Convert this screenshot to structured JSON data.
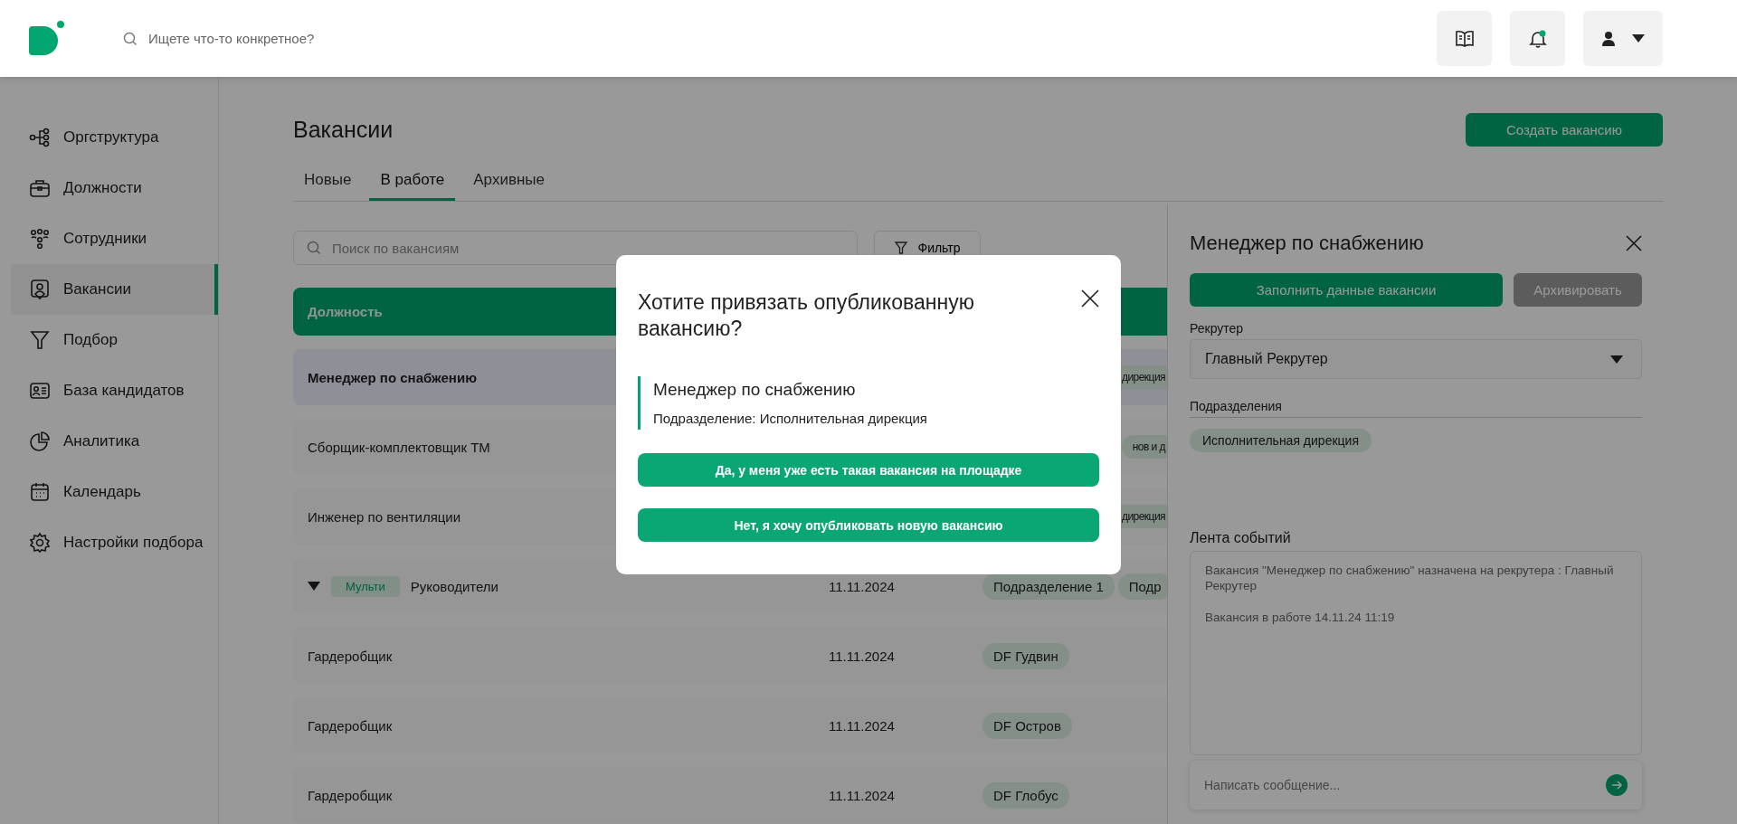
{
  "header": {
    "search": {
      "placeholder": "Ищете что-то конкретное?"
    },
    "notifications": {
      "unread": true
    }
  },
  "sidebar": {
    "items": [
      {
        "label": "Оргструктура",
        "selected": false
      },
      {
        "label": "Должности",
        "selected": false
      },
      {
        "label": "Сотрудники",
        "selected": false
      },
      {
        "label": "Вакансии",
        "selected": true
      },
      {
        "label": "Подбор",
        "selected": false
      },
      {
        "label": "База кандидатов",
        "selected": false
      },
      {
        "label": "Аналитика",
        "selected": false
      },
      {
        "label": "Календарь",
        "selected": false
      },
      {
        "label": "Настройки подбора",
        "selected": false
      }
    ]
  },
  "page": {
    "title": "Вакансии",
    "create_button": "Создать вакансию"
  },
  "tabs": [
    {
      "label": "Новые",
      "selected": false
    },
    {
      "label": "В работе",
      "selected": true
    },
    {
      "label": "Архивные",
      "selected": false
    }
  ],
  "search": {
    "placeholder": "Поиск по вакансиям"
  },
  "filter_button": "Фильтр",
  "table": {
    "columns": [
      "Должность"
    ],
    "rows": [
      {
        "kind": "single",
        "position": "Менеджер по снабжению",
        "selected": true,
        "departments": [
          "дирекция"
        ]
      },
      {
        "kind": "single",
        "position": "Сборщик-комплектовщик ТМ",
        "selected": false,
        "departments": [
          "нов и д"
        ]
      },
      {
        "kind": "single",
        "position": "Инженер по вентиляции",
        "selected": false,
        "departments": [
          "дирекция"
        ]
      },
      {
        "kind": "group",
        "badge": "Мульти",
        "position": "Руководители",
        "selected": false,
        "date": "11.11.2024",
        "departments": [
          "Подразделение 1",
          "Подр"
        ]
      },
      {
        "kind": "single",
        "position": "Гардеробщик",
        "selected": false,
        "date": "11.11.2024",
        "departments": [
          "DF Гудвин"
        ]
      },
      {
        "kind": "single",
        "position": "Гардеробщик",
        "selected": false,
        "date": "11.11.2024",
        "departments": [
          "DF Остров"
        ]
      },
      {
        "kind": "single",
        "position": "Гардеробщик",
        "selected": false,
        "date": "11.11.2024",
        "departments": [
          "DF Глобус"
        ]
      }
    ]
  },
  "drawer": {
    "title": "Менеджер по снабжению",
    "fill_button": "Заполнить данные вакансии",
    "archive_button": {
      "label": "Архивировать",
      "disabled": true
    },
    "recruiter": {
      "label": "Рекрутер",
      "value": "Главный Рекрутер"
    },
    "departments": {
      "label": "Подразделения",
      "tags": [
        "Исполнительная дирекция"
      ]
    },
    "feed": {
      "title": "Лента событий",
      "events": [
        "Вакансия \"Менеджер по снабжению\" назначена на рекрутера : Главный Рекрутер",
        "Вакансия в работе 14.11.24 11:19"
      ]
    },
    "message": {
      "placeholder": "Написать сообщение..."
    }
  },
  "modal": {
    "title": "Хотите привязать опубликованную вакансию?",
    "vacancy": {
      "title": "Менеджер по снабжению",
      "detail": "Подразделение: Исполнительная дирекция"
    },
    "buttons": [
      "Да, у меня уже есть такая вакансия на площадке",
      "Нет, я хочу опубликовать новую вакансию"
    ]
  }
}
